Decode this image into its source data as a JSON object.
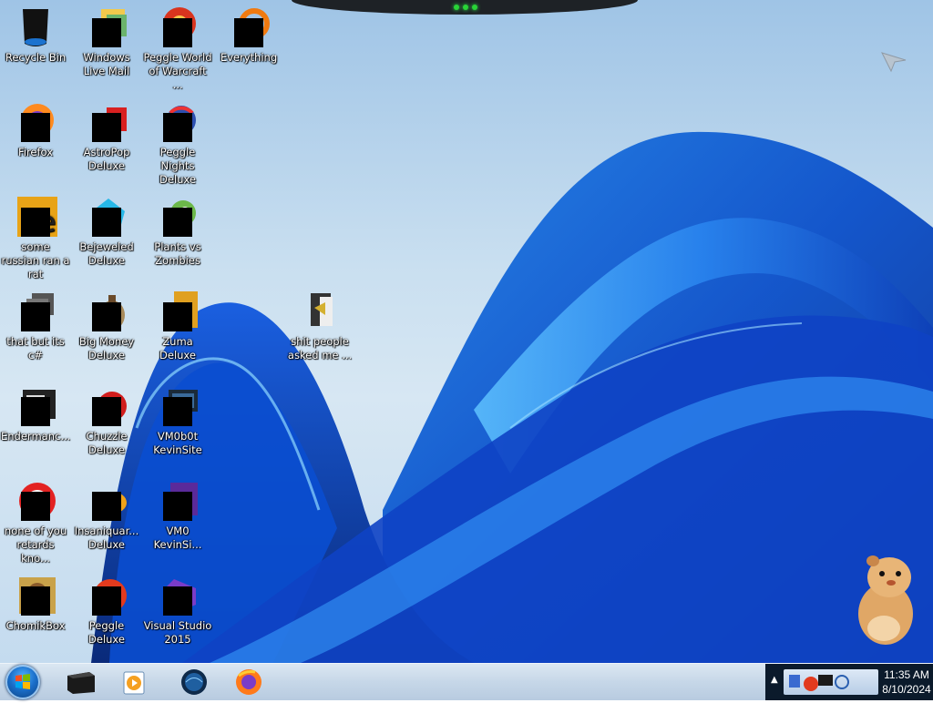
{
  "desktop_icons": [
    {
      "label": "Recycle Bin",
      "icon": "recycle-bin-icon"
    },
    {
      "label": "Windows Live Mail",
      "icon": "windows-live-mail-icon"
    },
    {
      "label": "Peggle World of Warcraft ...",
      "icon": "peggle-wow-icon"
    },
    {
      "label": "Everything",
      "icon": "everything-search-icon"
    },
    {
      "label": "Firefox",
      "icon": "firefox-icon"
    },
    {
      "label": "AstroPop Deluxe",
      "icon": "astropop-icon"
    },
    {
      "label": "Peggle Nights Deluxe",
      "icon": "peggle-nights-icon"
    },
    {
      "label": "some russian ran a rat",
      "icon": "rat-app-icon"
    },
    {
      "label": "Bejeweled Deluxe",
      "icon": "bejeweled-icon"
    },
    {
      "label": "Plants vs Zombies",
      "icon": "plants-vs-zombies-icon"
    },
    {
      "label": "that but its c#",
      "icon": "windows-stack-icon"
    },
    {
      "label": "Big Money Deluxe",
      "icon": "big-money-icon"
    },
    {
      "label": "Zuma Deluxe",
      "icon": "zuma-icon"
    },
    {
      "label": "shit people asked me ...",
      "icon": "folder-icon"
    },
    {
      "label": "Endermanc...",
      "icon": "console-app-icon"
    },
    {
      "label": "Chuzzle Deluxe",
      "icon": "chuzzle-icon"
    },
    {
      "label": "VM0b0t KevinSite",
      "icon": "vm-monitor-icon"
    },
    {
      "label": "none of you retards kno...",
      "icon": "red-circle-app-icon"
    },
    {
      "label": "Insaniquar... Deluxe",
      "icon": "insaniquarium-icon"
    },
    {
      "label": "VM0 KevinSi...",
      "icon": "vm-purple-icon"
    },
    {
      "label": "ChomikBox",
      "icon": "chomikbox-icon"
    },
    {
      "label": "Peggle Deluxe",
      "icon": "peggle-deluxe-icon"
    },
    {
      "label": "Visual Studio 2015",
      "icon": "visual-studio-icon"
    }
  ],
  "taskbar": {
    "start": "start-orb-icon",
    "pinned": [
      {
        "name": "black-box-app",
        "icon": "black-box-icon"
      },
      {
        "name": "media-player",
        "icon": "media-player-icon"
      },
      {
        "name": "globe-app",
        "icon": "globe-icon"
      },
      {
        "name": "firefox",
        "icon": "firefox-icon"
      }
    ],
    "tray": {
      "clock_time": "11:35 AM",
      "clock_date": "8/10/2024"
    }
  }
}
